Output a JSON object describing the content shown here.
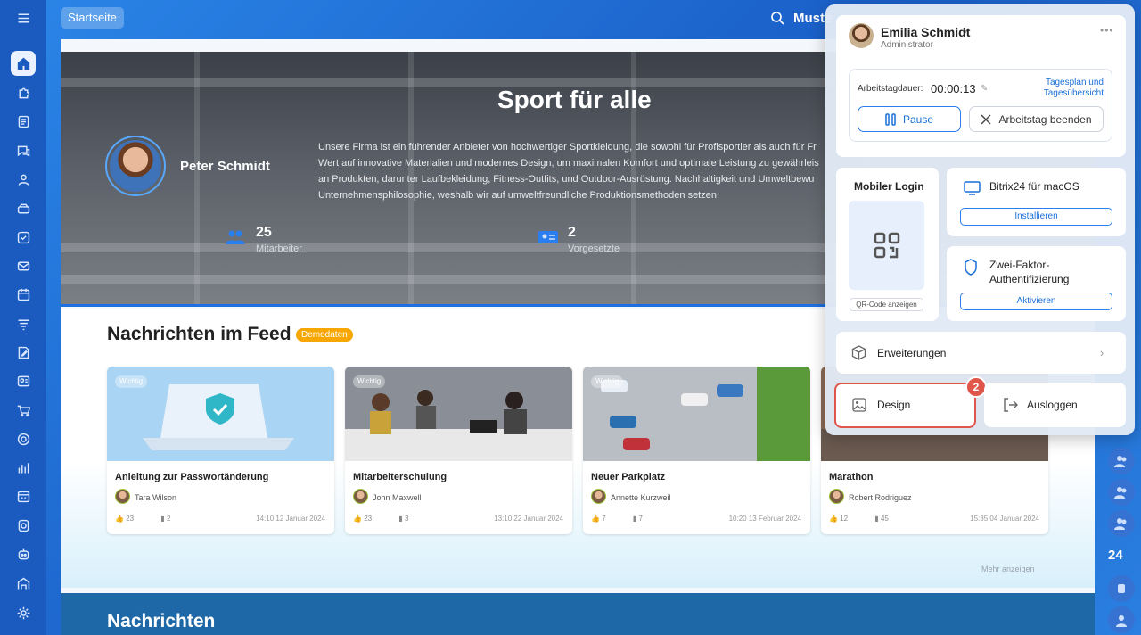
{
  "topbar": {
    "home_label": "Startseite",
    "search_text": "Muste"
  },
  "hero": {
    "title": "Sport für alle",
    "person_name": "Peter Schmidt",
    "description": "Unsere Firma ist ein führender Anbieter von hochwertiger Sportkleidung, die sowohl für Profisportler als auch für Fr Wert auf innovative Materialien und modernes Design, um maximalen Komfort und optimale Leistung zu gewährleis an Produkten, darunter Laufbekleidung, Fitness-Outfits, und Outdoor-Ausrüstung. Nachhaltigkeit und Umweltbewu Unternehmensphilosophie, weshalb wir auf umweltfreundliche Produktionsmethoden setzen.",
    "stats": [
      {
        "value": "25",
        "label": "Mitarbeiter",
        "icon": "people-icon"
      },
      {
        "value": "2",
        "label": "Vorgesetzte",
        "icon": "id-card-icon"
      }
    ]
  },
  "feed": {
    "title": "Nachrichten im Feed",
    "badge": "Demodaten",
    "more_label": "Mehr anzeigen",
    "cards": [
      {
        "tag": "Wichtig",
        "title": "Anleitung zur Passwortänderung",
        "author": "Tara Wilson",
        "likes": "23",
        "comments": "2",
        "date": "14:10 12 Januar 2024"
      },
      {
        "tag": "Wichtig",
        "title": "Mitarbeiterschulung",
        "author": "John Maxwell",
        "likes": "23",
        "comments": "3",
        "date": "13:10 22 Januar 2024"
      },
      {
        "tag": "Wichtig",
        "title": "Neuer Parkplatz",
        "author": "Annette Kurzweil",
        "likes": "7",
        "comments": "7",
        "date": "10:20 13 Februar 2024"
      },
      {
        "tag": "",
        "title": "Marathon",
        "author": "Robert Rodriguez",
        "likes": "12",
        "comments": "45",
        "date": "15:35 04 Januar 2024"
      }
    ]
  },
  "news": {
    "title": "Nachrichten"
  },
  "right_sidebar": {
    "counter": "24"
  },
  "popup": {
    "user": {
      "name": "Emilia Schmidt",
      "role": "Administrator"
    },
    "workday": {
      "label": "Arbeitstagdauer:",
      "time": "00:00:13",
      "link": "Tagesplan und Tagesübersicht",
      "pause_label": "Pause",
      "end_label": "Arbeitstag beenden"
    },
    "mobile": {
      "title": "Mobiler Login",
      "qr_button": "QR-Code anzeigen"
    },
    "mac": {
      "title": "Bitrix24 für macOS",
      "button": "Installieren"
    },
    "tfa": {
      "title": "Zwei-Faktor-Authentifizierung",
      "button": "Aktivieren"
    },
    "extensions": {
      "title": "Erweiterungen"
    },
    "design": {
      "title": "Design",
      "badge": "2"
    },
    "logout": {
      "title": "Ausloggen"
    }
  },
  "colors": {
    "accent": "#1a6fd8",
    "highlight": "#e0564a",
    "demo_badge": "#f7a700"
  }
}
